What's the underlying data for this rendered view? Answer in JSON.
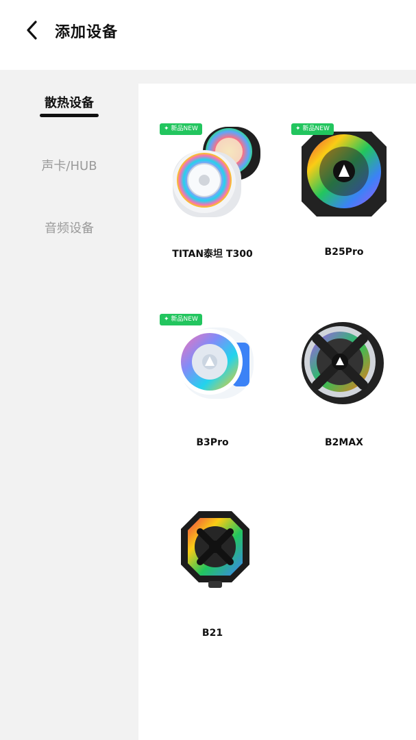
{
  "header": {
    "title": "添加设备"
  },
  "sidebar": {
    "categories": [
      {
        "label": "散热设备",
        "active": true
      },
      {
        "label": "声卡/HUB",
        "active": false
      },
      {
        "label": "音频设备",
        "active": false
      }
    ]
  },
  "products": [
    {
      "name": "TITAN泰坦 T300",
      "badge": "新品NEW",
      "icon": "cooler-white-black-pair-icon"
    },
    {
      "name": "B25Pro",
      "badge": "新品NEW",
      "icon": "cooler-rgb-round-icon"
    },
    {
      "name": "B3Pro",
      "badge": "新品NEW",
      "icon": "cooler-white-rgb-icon"
    },
    {
      "name": "B2MAX",
      "icon": "cooler-black-x-icon"
    },
    {
      "name": "B21",
      "icon": "cooler-hexagon-icon"
    }
  ],
  "colors": {
    "badge": "#22c55e",
    "text": "#111111",
    "inactive": "#9a9a9a",
    "sidebar_bg": "#f2f2f2"
  }
}
